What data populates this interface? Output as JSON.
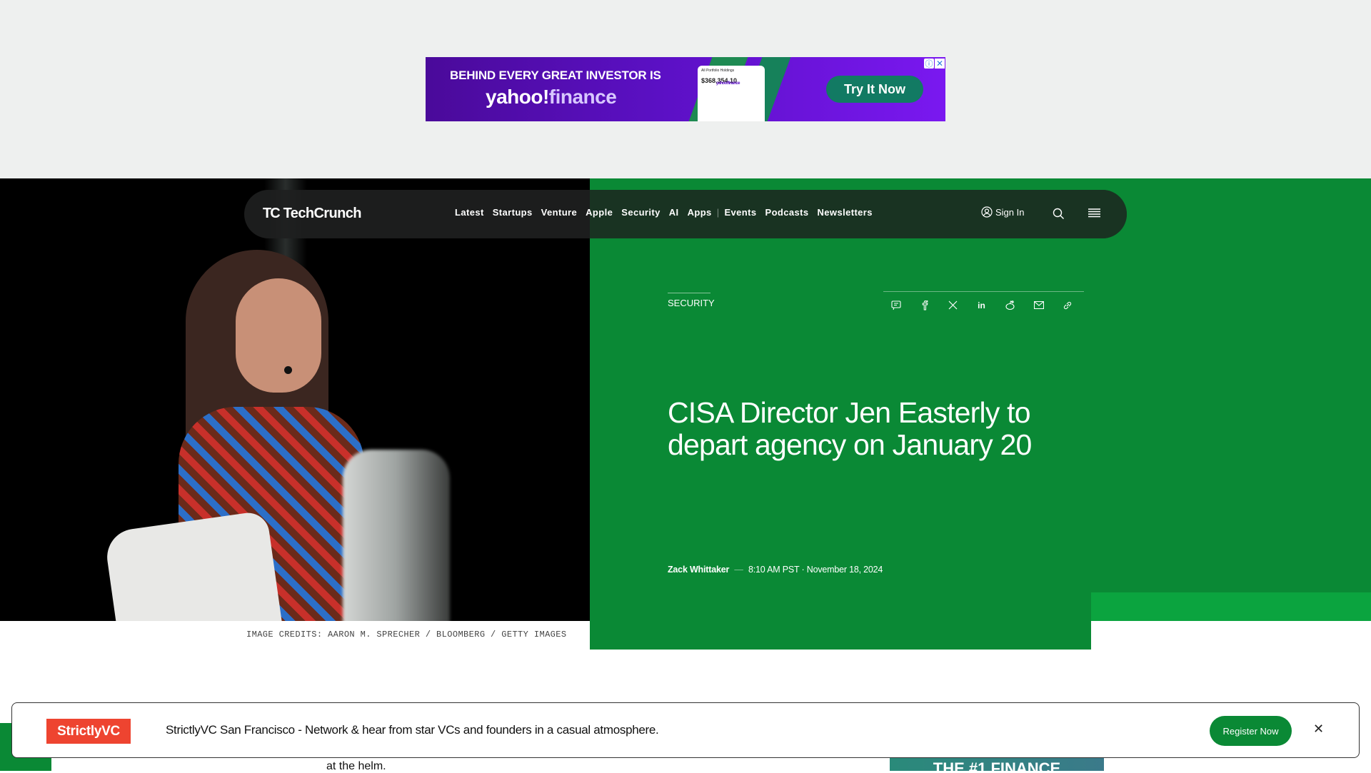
{
  "ad": {
    "headline": "BEHIND EVERY GREAT INVESTOR IS",
    "brand_main": "yahoo!",
    "brand_suffix": "finance",
    "phone_logo": "yahoo!finance",
    "phone_label": "All Portfolio Holdings",
    "phone_balance": "$368,354.10",
    "cta": "Try It Now",
    "info_icon": "info-icon",
    "close_icon": "close-icon"
  },
  "nav": {
    "logo": "TechCrunch",
    "logo_mark": "TC",
    "links": [
      "Latest",
      "Startups",
      "Venture",
      "Apple",
      "Security",
      "AI",
      "Apps",
      "Events",
      "Podcasts",
      "Newsletters"
    ],
    "sign_in": "Sign In"
  },
  "article": {
    "category": "SECURITY",
    "headline": "CISA Director Jen Easterly to depart agency on January 20",
    "author": "Zack Whittaker",
    "time": "8:10 AM PST",
    "date": "November 18, 2024",
    "image_credits": "IMAGE CREDITS: AARON M. SPRECHER / BLOOMBERG / GETTY IMAGES",
    "share_icons": [
      "comment-icon",
      "facebook-icon",
      "x-icon",
      "linkedin-icon",
      "reddit-icon",
      "email-icon",
      "link-icon"
    ]
  },
  "below": {
    "body_fragment": "at the helm.",
    "side_ad_text": "THE #1 FINANCE"
  },
  "banner": {
    "logo": "StrictlyVC",
    "message": "StrictlyVC San Francisco - Network & hear from star VCs and founders in a casual atmosphere.",
    "cta": "Register Now"
  },
  "colors": {
    "brand_green": "#0a8935",
    "accent_green": "#0ba43f",
    "strictlyvc_red": "#ee4430"
  }
}
